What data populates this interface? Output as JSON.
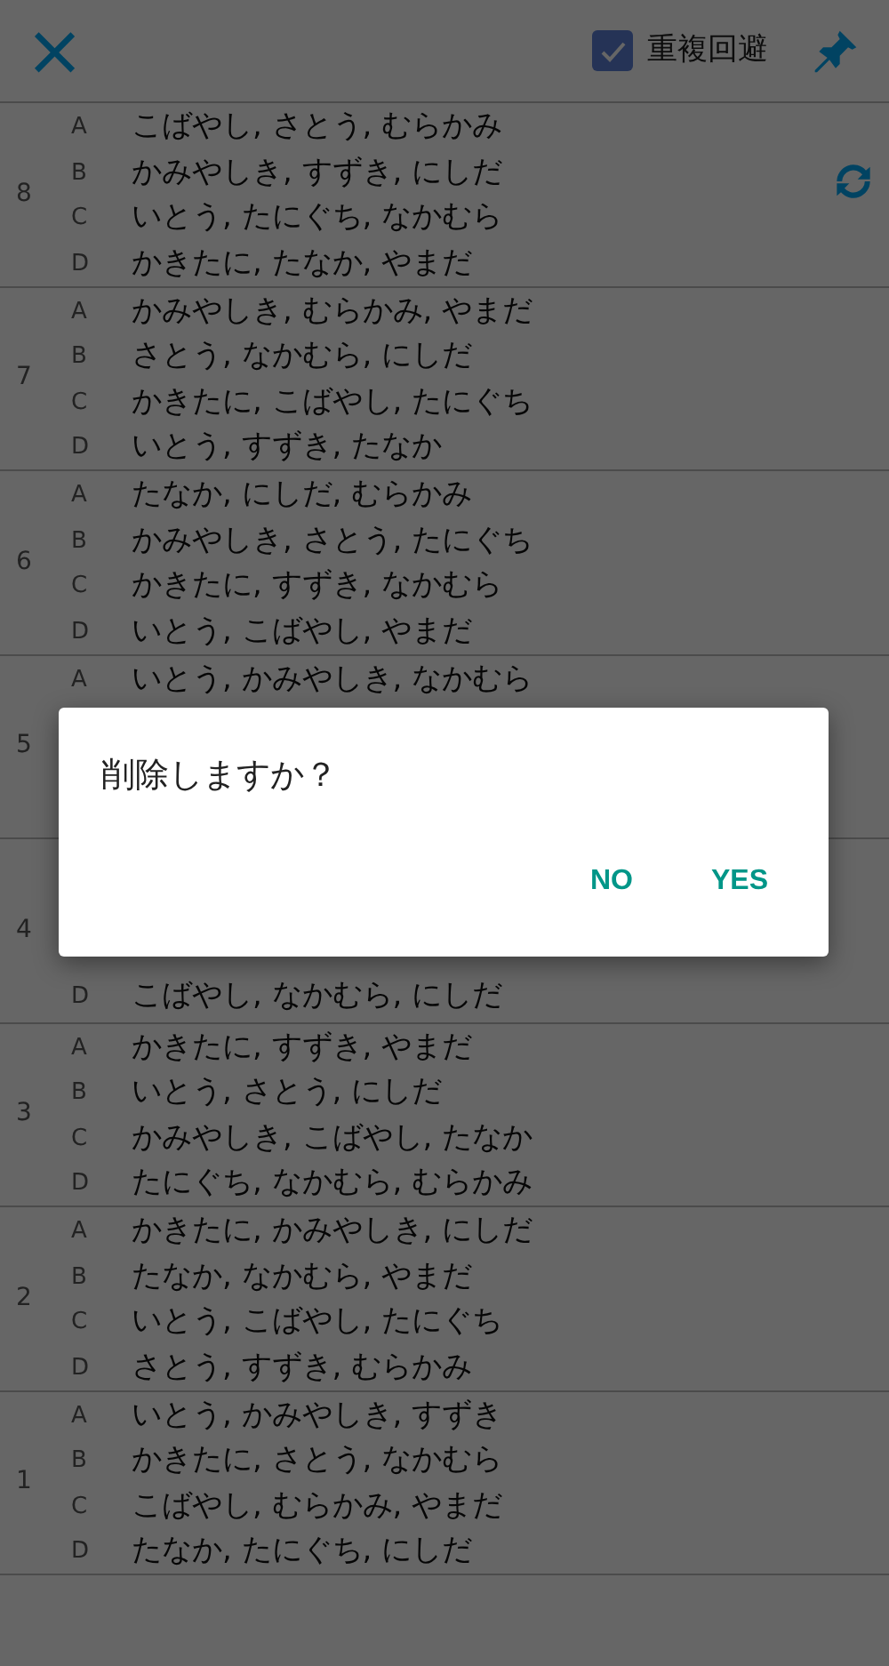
{
  "toolbar": {
    "close": "×",
    "dedupe": {
      "label": "重複回避",
      "checked": true
    }
  },
  "groups": [
    {
      "number": "8",
      "kind": "full",
      "lines": [
        {
          "letter": "A",
          "text": "こばやし, さとう, むらかみ"
        },
        {
          "letter": "B",
          "text": "かみやしき, すずき, にしだ"
        },
        {
          "letter": "C",
          "text": "いとう, たにぐち, なかむら"
        },
        {
          "letter": "D",
          "text": "かきたに, たなか, やまだ"
        }
      ]
    },
    {
      "number": "7",
      "kind": "full",
      "lines": [
        {
          "letter": "A",
          "text": "かみやしき, むらかみ, やまだ"
        },
        {
          "letter": "B",
          "text": "さとう, なかむら, にしだ"
        },
        {
          "letter": "C",
          "text": "かきたに, こばやし, たにぐち"
        },
        {
          "letter": "D",
          "text": "いとう, すずき, たなか"
        }
      ]
    },
    {
      "number": "6",
      "kind": "full",
      "lines": [
        {
          "letter": "A",
          "text": "たなか, にしだ, むらかみ"
        },
        {
          "letter": "B",
          "text": "かみやしき, さとう, たにぐち"
        },
        {
          "letter": "C",
          "text": "かきたに, すずき, なかむら"
        },
        {
          "letter": "D",
          "text": "いとう, こばやし, やまだ"
        }
      ]
    },
    {
      "number": "5",
      "kind": "head",
      "lines": [
        {
          "letter": "A",
          "text": "いとう, かみやしき, なかむら"
        }
      ]
    },
    {
      "number": "4",
      "kind": "tail",
      "lines": [
        {
          "letter": "D",
          "text": "こばやし, なかむら, にしだ"
        }
      ]
    },
    {
      "number": "3",
      "kind": "full",
      "lines": [
        {
          "letter": "A",
          "text": "かきたに, すずき, やまだ"
        },
        {
          "letter": "B",
          "text": "いとう, さとう, にしだ"
        },
        {
          "letter": "C",
          "text": "かみやしき, こばやし, たなか"
        },
        {
          "letter": "D",
          "text": "たにぐち, なかむら, むらかみ"
        }
      ]
    },
    {
      "number": "2",
      "kind": "full",
      "lines": [
        {
          "letter": "A",
          "text": "かきたに, かみやしき, にしだ"
        },
        {
          "letter": "B",
          "text": "たなか, なかむら, やまだ"
        },
        {
          "letter": "C",
          "text": "いとう, こばやし, たにぐち"
        },
        {
          "letter": "D",
          "text": "さとう, すずき, むらかみ"
        }
      ]
    },
    {
      "number": "1",
      "kind": "full",
      "lines": [
        {
          "letter": "A",
          "text": "いとう, かみやしき, すずき"
        },
        {
          "letter": "B",
          "text": "かきたに, さとう, なかむら"
        },
        {
          "letter": "C",
          "text": "こばやし, むらかみ, やまだ"
        },
        {
          "letter": "D",
          "text": "たなか, たにぐち, にしだ"
        }
      ]
    }
  ],
  "dialog": {
    "message": "削除しますか？",
    "buttons": [
      "NO",
      "YES"
    ]
  }
}
